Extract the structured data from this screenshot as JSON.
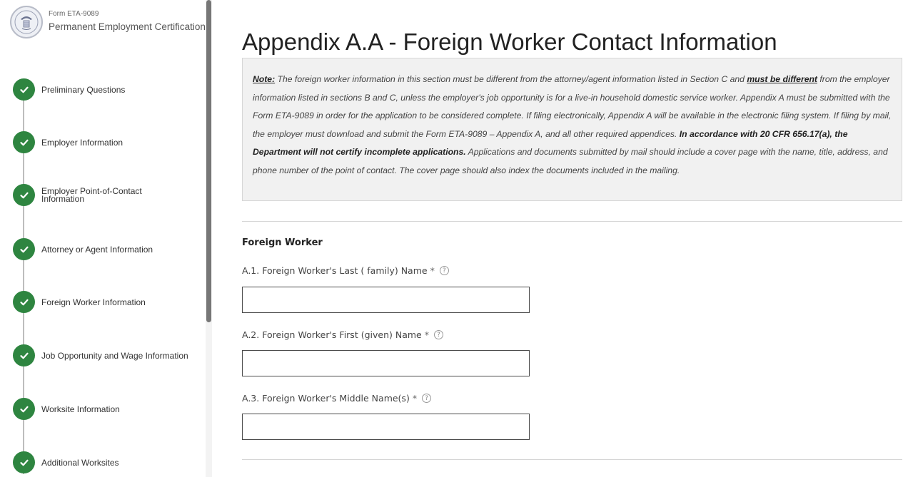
{
  "app": {
    "form_number": "Form ETA-9089",
    "app_name": "Permanent Employment Certification"
  },
  "sidebar": {
    "steps": [
      {
        "label": "Preliminary Questions",
        "status": "complete"
      },
      {
        "label": "Employer Information",
        "status": "complete"
      },
      {
        "label": "Employer Point-of-Contact Information",
        "status": "complete"
      },
      {
        "label": "Attorney or Agent Information",
        "status": "complete"
      },
      {
        "label": "Foreign Worker Information",
        "status": "complete"
      },
      {
        "label": "Job Opportunity and Wage Information",
        "status": "complete"
      },
      {
        "label": "Worksite Information",
        "status": "complete"
      },
      {
        "label": "Additional Worksites",
        "status": "complete"
      }
    ]
  },
  "page": {
    "title": "Appendix A.A - Foreign Worker Contact Information"
  },
  "note": {
    "lead": "Note:",
    "p1": " The foreign worker information in this section must be different from the attorney/agent information listed in Section C and ",
    "emph1": "must be different",
    "p2": " from the employer information listed in sections B and C, unless the employer's job opportunity is for a live-in household domestic service worker. Appendix A must be submitted with the Form ETA-9089 in order for the application to be considered complete. If filing electronically, Appendix A will be available in the electronic filing system. If filing by mail, the employer must download and submit the Form ETA-9089 – Appendix A, and all other required appendices. ",
    "emph2": "In accordance with 20 CFR 656.17(a), the Department will not certify incomplete applications.",
    "p3": " Applications and documents submitted by mail should include a cover page with the name, title, address, and phone number of the point of contact. The cover page should also index the documents included in the mailing."
  },
  "section": {
    "heading": "Foreign Worker",
    "fields": [
      {
        "label": "A.1. Foreign Worker's Last ( family) Name",
        "required_mark": "*",
        "help": "?",
        "value": ""
      },
      {
        "label": "A.2. Foreign Worker's First (given) Name",
        "required_mark": "*",
        "help": "?",
        "value": ""
      },
      {
        "label": "A.3. Foreign Worker's Middle Name(s)",
        "required_mark": "*",
        "help": "?",
        "value": ""
      }
    ]
  },
  "colors": {
    "complete": "#2e8540",
    "note_bg": "#f1f1f1"
  }
}
